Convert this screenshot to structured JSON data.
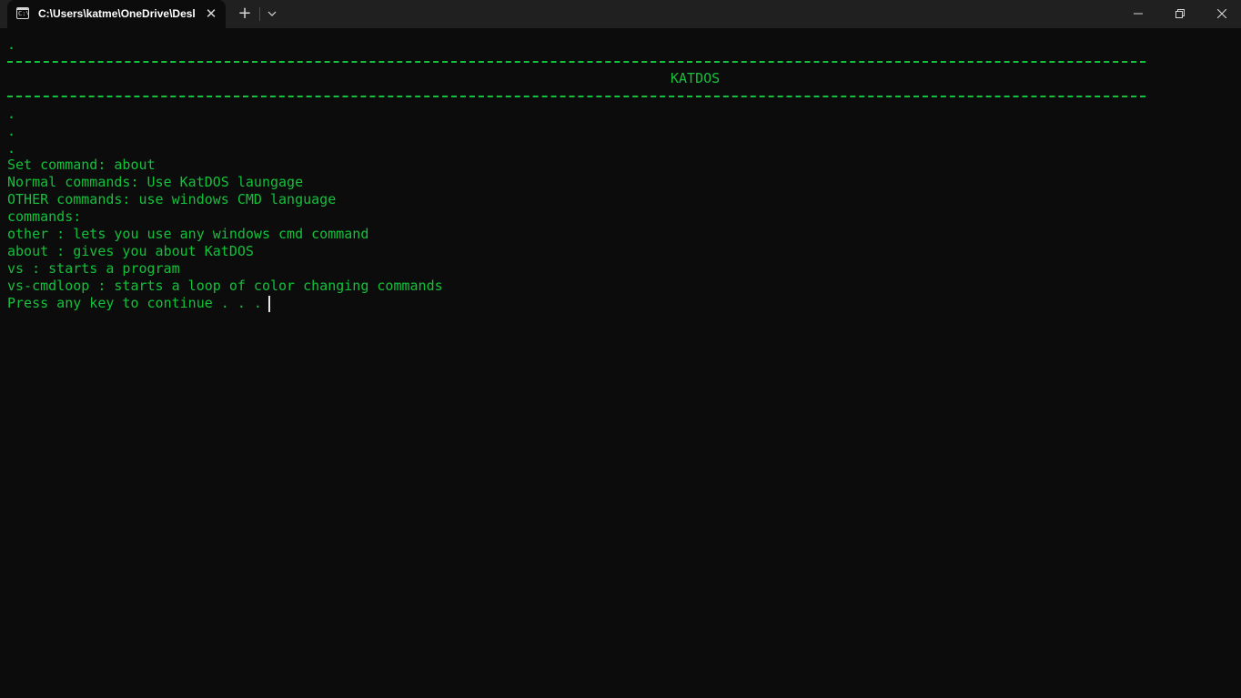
{
  "window": {
    "tab_title": "C:\\Users\\katme\\OneDrive\\Desktop",
    "tab_icon_glyph": "C:\\",
    "close_tab_glyph": "✕",
    "new_tab_glyph": "+",
    "icons": {
      "tab": "terminal-icon",
      "close_tab": "close-icon",
      "new_tab": "plus-icon",
      "dropdown": "chevron-down-icon",
      "minimize": "minimize-icon",
      "maximize": "restore-icon",
      "close": "close-icon"
    }
  },
  "terminal": {
    "colors": {
      "foreground": "#13c13a",
      "background": "#0c0c0c",
      "cursor": "#e6e6e6"
    },
    "dot_top": ".",
    "banner": "KATDOS",
    "dots": [
      ".",
      ".",
      "."
    ],
    "lines": [
      "Set command: about",
      "Normal commands: Use KatDOS laungage",
      "OTHER commands: use windows CMD language",
      "commands:",
      "other : lets you use any windows cmd command",
      "about : gives you about KatDOS",
      "vs : starts a program",
      "vs-cmdloop : starts a loop of color changing commands",
      "Press any key to continue . . . "
    ]
  }
}
